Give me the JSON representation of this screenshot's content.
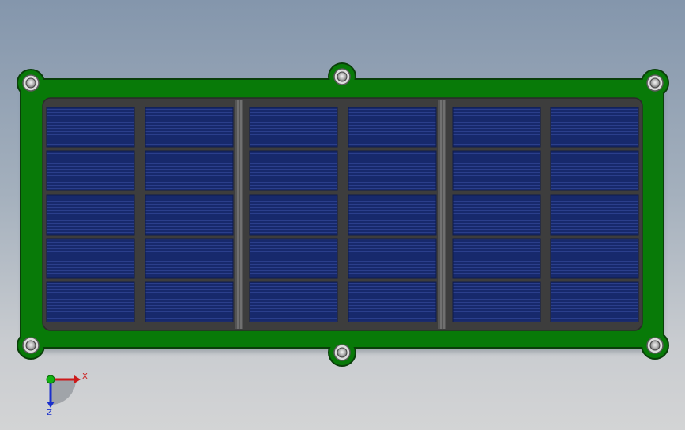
{
  "model": {
    "board_color": "#087a08",
    "board_edge_color": "#0a3f0a",
    "frame_color": "#3d3d3d",
    "cell_color": "#17296c",
    "cell_line_color": "#2b3f8c",
    "cell_columns": 6,
    "cell_rows": 5,
    "mounting_holes": 6,
    "module_groups": 3
  },
  "triad": {
    "x_label": "X",
    "z_label": "Z",
    "x_color": "#cc1a1a",
    "y_color": "#12b212",
    "z_color": "#1a2fcc"
  }
}
